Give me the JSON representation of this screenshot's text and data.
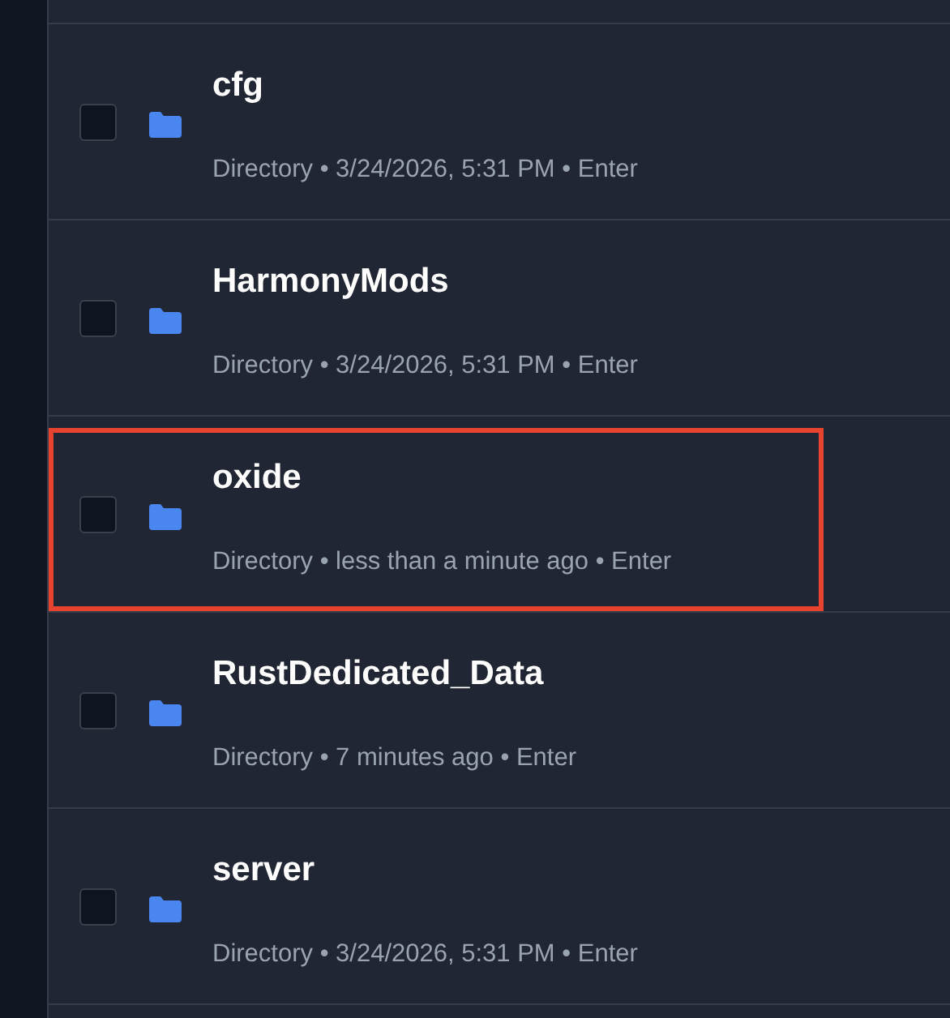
{
  "items": [
    {
      "name": "cfg",
      "meta": "Directory • 3/24/2026, 5:31 PM • Enter",
      "checked": false,
      "highlighted": false
    },
    {
      "name": "HarmonyMods",
      "meta": "Directory • 3/24/2026, 5:31 PM • Enter",
      "checked": false,
      "highlighted": false
    },
    {
      "name": "oxide",
      "meta": "Directory • less than a minute ago • Enter",
      "checked": false,
      "highlighted": true
    },
    {
      "name": "RustDedicated_Data",
      "meta": "Directory • 7 minutes ago • Enter",
      "checked": false,
      "highlighted": false
    },
    {
      "name": "server",
      "meta": "Directory • 3/24/2026, 5:31 PM • Enter",
      "checked": false,
      "highlighted": false
    }
  ]
}
